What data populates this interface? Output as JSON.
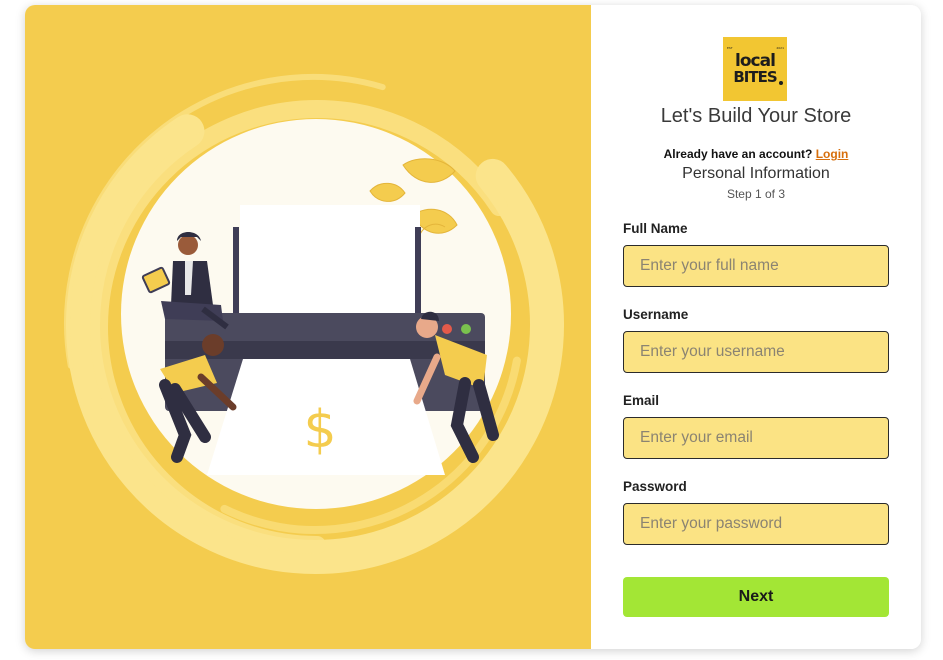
{
  "brand": {
    "logo_line1": "local",
    "logo_line2": "BITES",
    "logo_small_left": "EST",
    "logo_small_right": "2021",
    "accent": "#f4cc4e"
  },
  "header": {
    "title": "Let's Build Your Store",
    "have_account_text": "Already have an account?",
    "login_link": "Login",
    "section_title": "Personal Information",
    "step_text": "Step 1 of 3"
  },
  "form": {
    "fields": [
      {
        "label": "Full Name",
        "placeholder": "Enter your full name",
        "value": ""
      },
      {
        "label": "Username",
        "placeholder": "Enter your username",
        "value": ""
      },
      {
        "label": "Email",
        "placeholder": "Enter your email",
        "value": ""
      },
      {
        "label": "Password",
        "placeholder": "Enter your password",
        "value": ""
      }
    ],
    "next_label": "Next",
    "next_color": "#a3e635"
  },
  "illustration": {
    "currency_symbol": "$"
  }
}
